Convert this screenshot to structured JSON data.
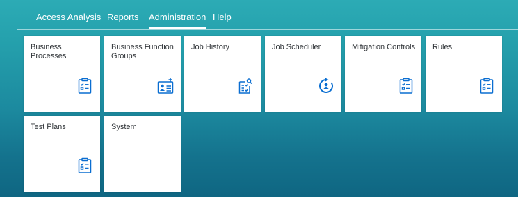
{
  "nav": {
    "tabs": [
      {
        "label": "Access Analysis",
        "active": false
      },
      {
        "label": "Reports",
        "active": false
      },
      {
        "label": "Administration",
        "active": true
      },
      {
        "label": "Help",
        "active": false
      }
    ]
  },
  "tiles": [
    {
      "title": "Business Processes",
      "icon": "clipboard-checklist-icon"
    },
    {
      "title": "Business Function Groups",
      "icon": "add-contact-icon"
    },
    {
      "title": "Job History",
      "icon": "document-search-icon"
    },
    {
      "title": "Job Scheduler",
      "icon": "user-cycle-icon"
    },
    {
      "title": "Mitigation Controls",
      "icon": "clipboard-checklist-icon"
    },
    {
      "title": "Rules",
      "icon": "clipboard-checklist-icon"
    },
    {
      "title": "Test Plans",
      "icon": "clipboard-checklist-icon"
    },
    {
      "title": "System",
      "icon": "none"
    }
  ],
  "colors": {
    "accent": "#0a6ed1",
    "tile_text": "#32363a",
    "background_top": "#2cabb5",
    "background_bottom": "#0f6682"
  }
}
